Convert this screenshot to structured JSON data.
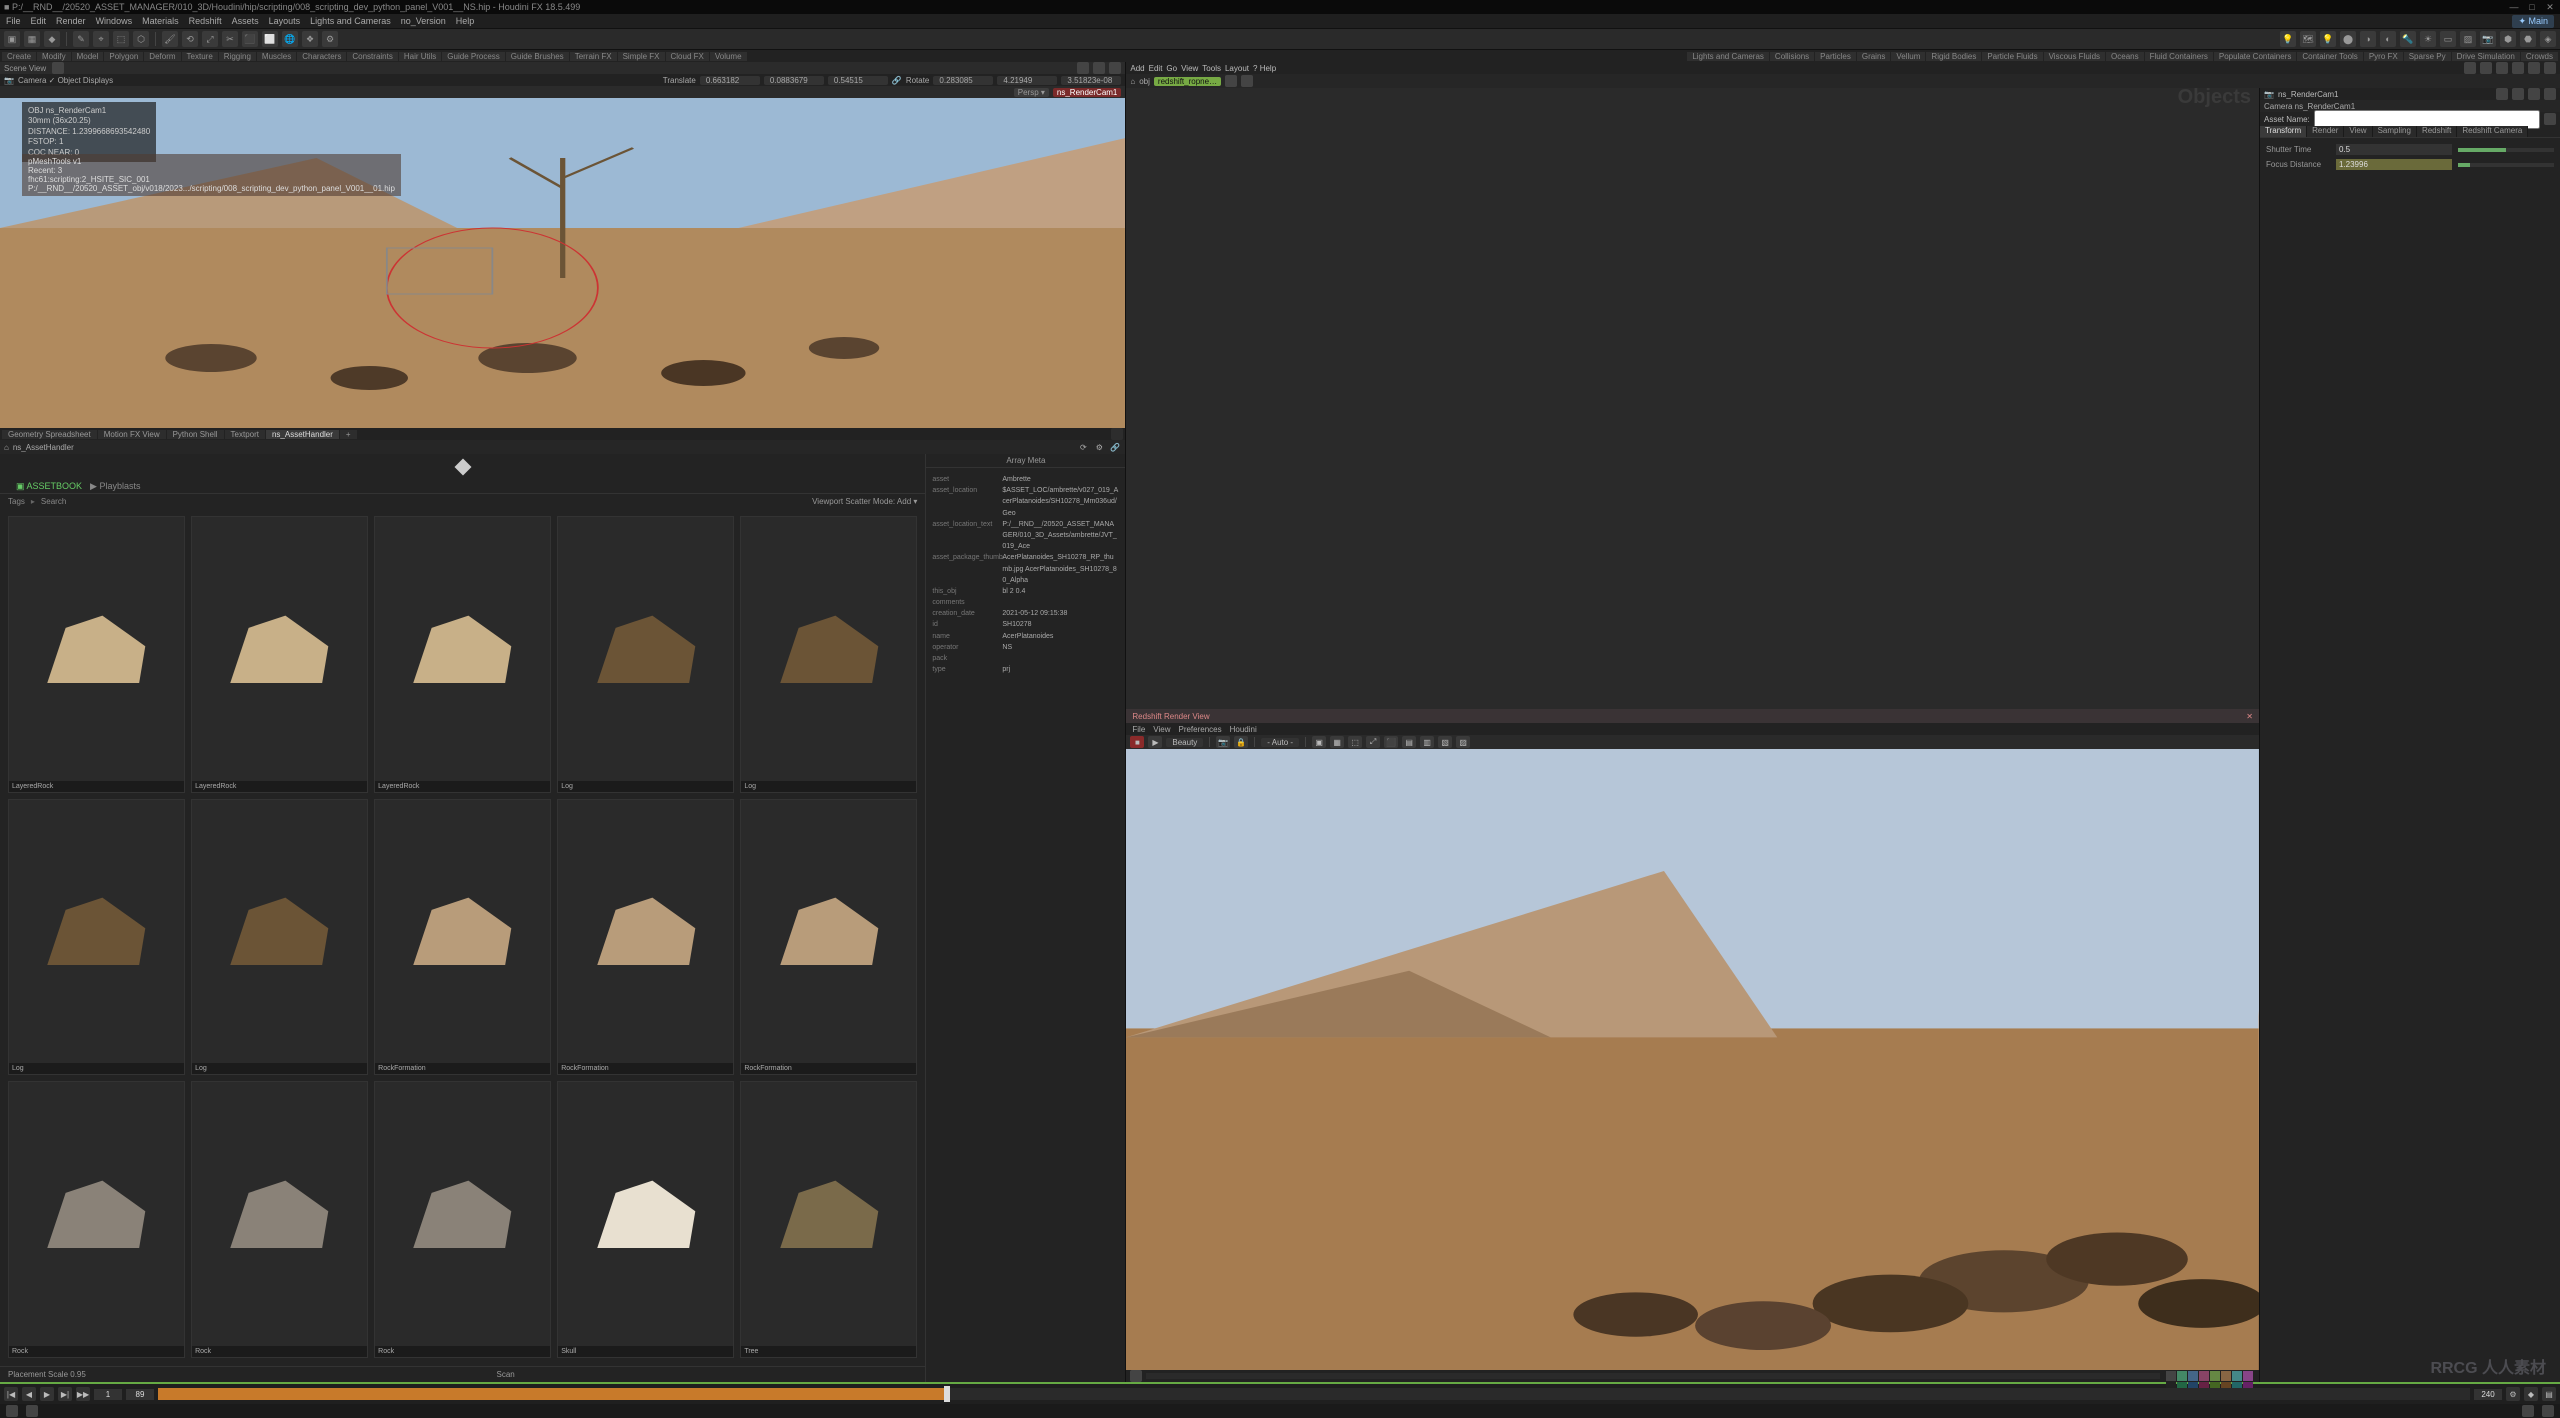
{
  "title": "P:/__RND__/20520_ASSET_MANAGER/010_3D/Houdini/hip/scripting/008_scripting_dev_python_panel_V001__NS.hip - Houdini FX 18.5.499",
  "menu": [
    "File",
    "Edit",
    "Render",
    "Windows",
    "Materials",
    "Redshift",
    "Assets",
    "Layouts",
    "Lights and Cameras",
    "no_Version",
    "Help"
  ],
  "shelf_tabs": [
    "Create",
    "Modify",
    "Model",
    "Polygon",
    "Deform",
    "Texture",
    "Rigging",
    "Muscles",
    "Characters",
    "Constraints",
    "Hair Utils",
    "Guide Process",
    "Guide Brushes",
    "Terrain FX",
    "Simple FX",
    "Cloud FX",
    "Volume"
  ],
  "shelf_tabs2": [
    "Lights and Cameras",
    "Collisions",
    "Particles",
    "Grains",
    "Vellum",
    "Rigid Bodies",
    "Particle Fluids",
    "Viscous Fluids",
    "Oceans",
    "Fluid Containers",
    "Populate Containers",
    "Container Tools",
    "Pyro FX",
    "Sparse Py",
    "Drive Simulation",
    "Crowds"
  ],
  "viewer": {
    "camera_label": "Camera ✓ Object Displays",
    "translate_label": "Translate",
    "translate": [
      "0.663182",
      "0.0883679",
      "0.54515"
    ],
    "rotate_label": "Rotate",
    "rotate": [
      "0.283085",
      "4.21949",
      "3.51823e-08"
    ],
    "persp_pill": "Persp ▾",
    "node_pill": "ns_RenderCam1",
    "info": [
      "OBJ ns_RenderCam1",
      "30mm (36x20.25)",
      "DISTANCE: 1.2399668693542480",
      "FSTOP: 1",
      "COC NEAR: 0"
    ],
    "recent": [
      "pMeshTools v1",
      "Recent: 3",
      "fhc61:scripting:2_HSITE_SIC_001",
      "P:/__RND__/20520_ASSET_obj/v018/2023.../scripting/008_scripting_dev_python_panel_V001__01.hip"
    ]
  },
  "panel_tabs": [
    "Geometry Spreadsheet",
    "Motion FX View",
    "Python Shell",
    "Textport",
    "ns_AssetHandler",
    "+"
  ],
  "panel_active": "ns_AssetHandler",
  "asset": {
    "path": "ns_AssetHandler",
    "tabs": [
      "",
      "ASSETBOOK",
      "Playblasts",
      ""
    ],
    "tags": "Tags",
    "search": "Search",
    "scatter_mode": "Viewport Scatter Mode:",
    "scatter_value": "Add",
    "meta_header": "Array Meta",
    "placement": "Placement Scale   0.95",
    "scan": "Scan",
    "assets": [
      {
        "n": "LayeredRock"
      },
      {
        "n": "LayeredRock"
      },
      {
        "n": "LayeredRock"
      },
      {
        "n": "Log"
      },
      {
        "n": "Log"
      },
      {
        "n": "Log"
      },
      {
        "n": "Log"
      },
      {
        "n": "RockFormation"
      },
      {
        "n": "RockFormation"
      },
      {
        "n": "RockFormation"
      },
      {
        "n": "Rock"
      },
      {
        "n": "Rock"
      },
      {
        "n": "Rock"
      },
      {
        "n": "Skull"
      },
      {
        "n": "Tree"
      }
    ],
    "meta": [
      {
        "k": "asset",
        "v": "Ambrette"
      },
      {
        "k": "asset_location",
        "v": "$ASSET_LOC/ambrette/v027_019_AcerPlatanoides/SH10278_Mm036ud/Geo"
      },
      {
        "k": "asset_location_text",
        "v": "P:/__RND__/20520_ASSET_MANAGER/010_3D_Assets/ambrette/JVT_019_Ace"
      },
      {
        "k": "asset_package_thumb",
        "v": "AcerPlatanoides_SH10278_RP_thumb.jpg  AcerPlatanoides_SH10278_80_Alpha"
      },
      {
        "k": "this_obj",
        "v": "bl 2 0.4"
      },
      {
        "k": "comments",
        "v": ""
      },
      {
        "k": "creation_date",
        "v": "2021-05-12 09:15:38"
      },
      {
        "k": "id",
        "v": "SH10278"
      },
      {
        "k": "name",
        "v": "AcerPlatanoides"
      },
      {
        "k": "operator",
        "v": "NS"
      },
      {
        "k": "pack",
        "v": ""
      },
      {
        "k": "type",
        "v": "prj"
      }
    ]
  },
  "network": {
    "top_menu": [
      "Add",
      "Edit",
      "Go",
      "View",
      "Tools",
      "Layout",
      "Help"
    ],
    "path": "obj",
    "crumb": "redshift_ropne…",
    "obj_label": "Objects",
    "shelf2_extra": [
      "DomeLight",
      "PhysicalSky",
      "IES Light",
      "Area Light",
      "Point Light",
      "Spot Light",
      "Directional Light",
      "Portal Light",
      "Mesh Light",
      "RS Proxy",
      "Volume",
      "Camera",
      "StandardVol",
      "RS Spare P"
    ]
  },
  "render": {
    "tab": "Redshift Render View",
    "menu": [
      "File",
      "View",
      "Preferences",
      "Houdini"
    ],
    "aov": "Beauty",
    "auto": "- Auto -"
  },
  "params": {
    "crumb": "Camera  ns_RenderCam1",
    "name": "Asset Name:",
    "tabs": [
      "Transform",
      "Render",
      "View",
      "Sampling",
      "Redshift",
      "Redshift Camera"
    ],
    "rows": [
      {
        "l": "Shutter Time",
        "v": "0.5"
      },
      {
        "l": "Focus Distance",
        "v": "1.23996"
      }
    ]
  },
  "timeline": {
    "start": "1",
    "cur": "89",
    "end": "240"
  },
  "status": {
    "left": "",
    "right": [
      "",
      ""
    ]
  },
  "swatches": [
    [
      "#888",
      "#6a8",
      "#68a",
      "#a68",
      "#8a6",
      "#a86",
      "#6aa",
      "#a6a"
    ],
    [
      "#444",
      "#486",
      "#468",
      "#846",
      "#684",
      "#864",
      "#488",
      "#848"
    ],
    [
      "#222",
      "#264",
      "#246",
      "#624",
      "#462",
      "#642",
      "#266",
      "#626"
    ]
  ],
  "wm": "RRCG 人人素材"
}
